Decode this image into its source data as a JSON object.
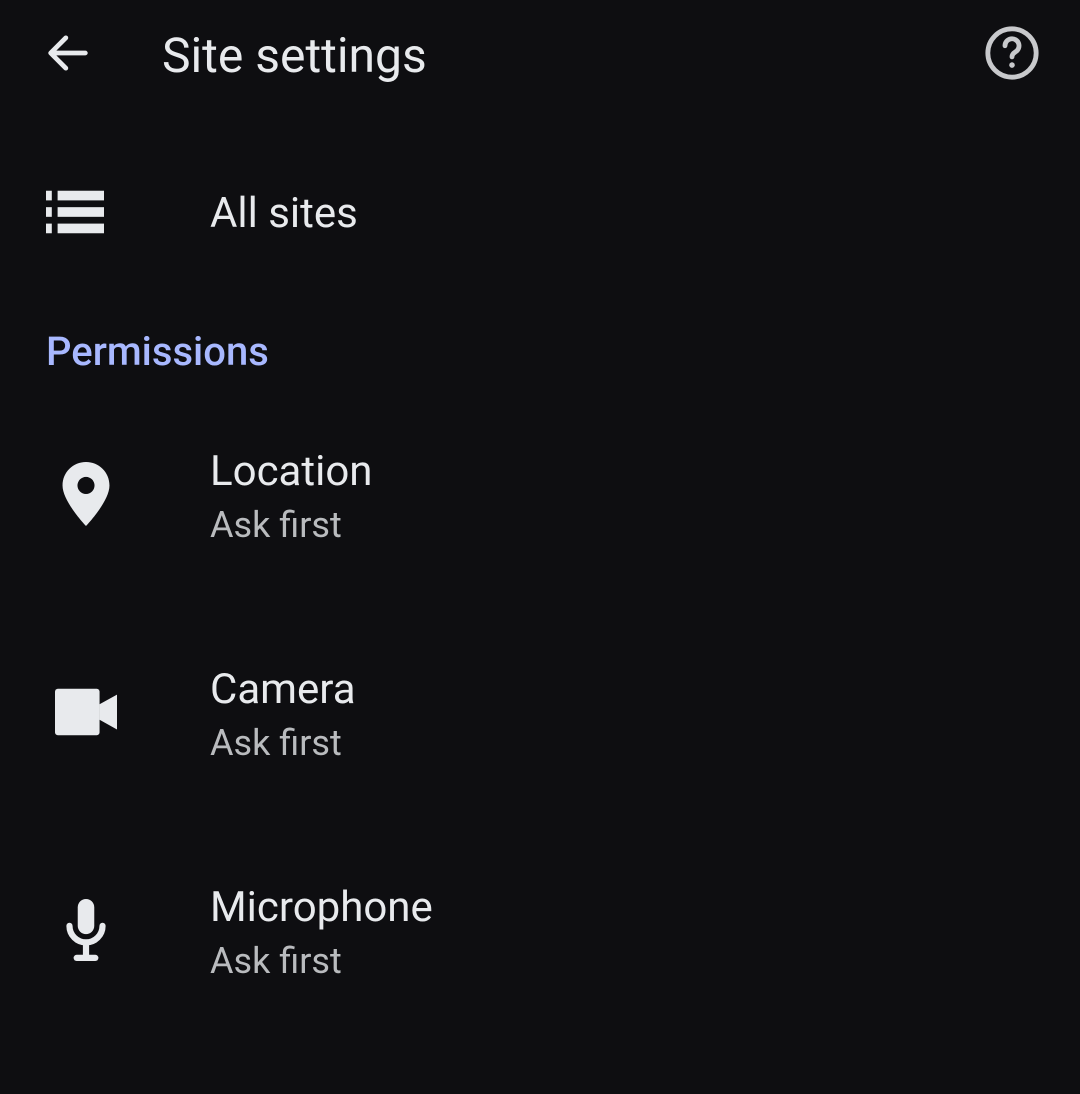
{
  "header": {
    "title": "Site settings"
  },
  "allSites": {
    "label": "All sites"
  },
  "sectionHeader": "Permissions",
  "permissions": [
    {
      "label": "Location",
      "status": "Ask first"
    },
    {
      "label": "Camera",
      "status": "Ask first"
    },
    {
      "label": "Microphone",
      "status": "Ask first"
    }
  ]
}
